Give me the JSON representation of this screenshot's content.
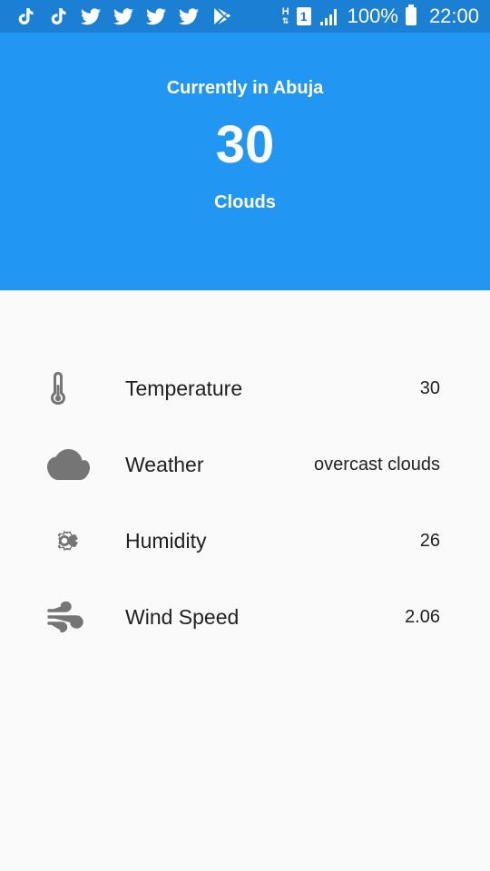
{
  "status_bar": {
    "battery": "100%",
    "time": "22:00",
    "network_h": "H",
    "sim_slot": "1"
  },
  "header": {
    "location": "Currently in Abuja",
    "temperature": "30",
    "condition": "Clouds"
  },
  "details": [
    {
      "icon": "thermometer-icon",
      "label": "Temperature",
      "value": "30"
    },
    {
      "icon": "cloud-icon",
      "label": "Weather",
      "value": "overcast clouds"
    },
    {
      "icon": "gear-icon",
      "label": "Humidity",
      "value": "26"
    },
    {
      "icon": "wind-icon",
      "label": "Wind Speed",
      "value": "2.06"
    }
  ],
  "colors": {
    "status_bar": "#1b7fd3",
    "header": "#2196f3",
    "icon": "#757575",
    "background": "#fafafa"
  }
}
